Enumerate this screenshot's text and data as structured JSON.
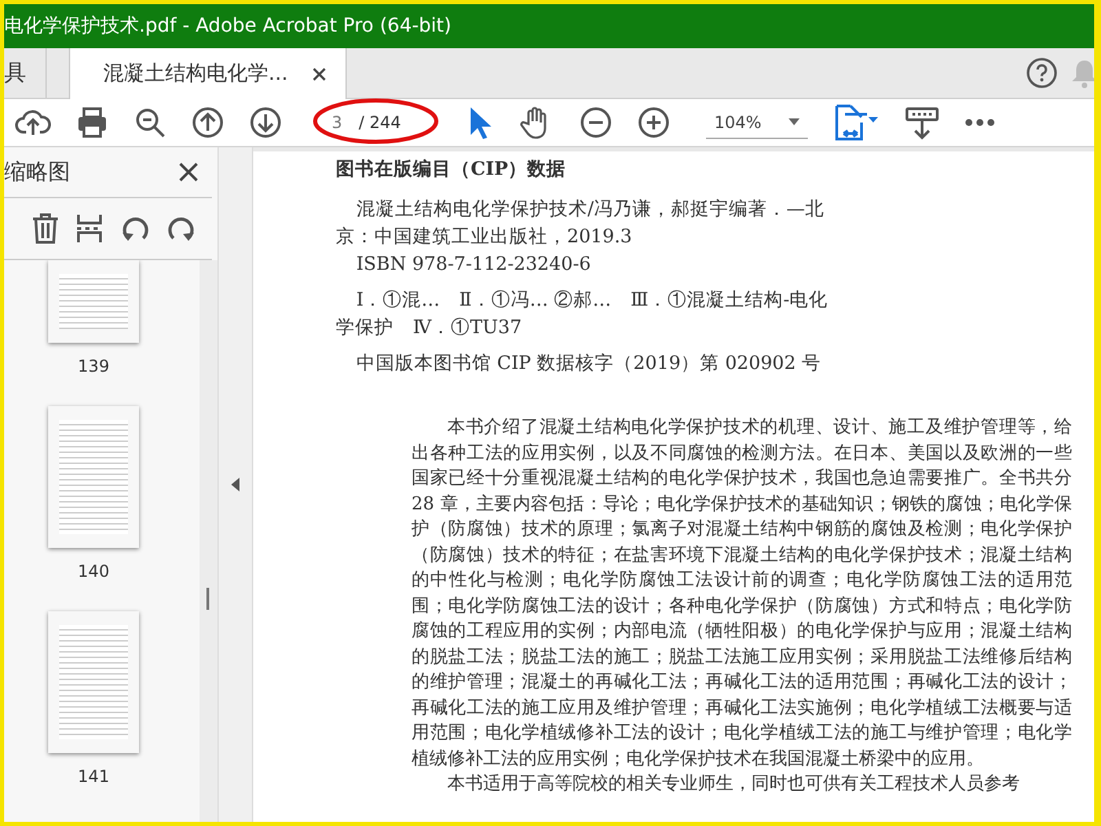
{
  "window": {
    "title": "电化学保护技术.pdf - Adobe Acrobat Pro (64-bit)"
  },
  "tabs": [
    {
      "label": "具",
      "selected": false
    },
    {
      "label": "混凝土结构电化学...",
      "selected": true
    }
  ],
  "toolbar": {
    "page_current": "3",
    "page_total": "/ 244",
    "zoom": "104%"
  },
  "sidebar": {
    "title": "缩略图",
    "thumbnails": [
      {
        "label": "139",
        "selected": false
      },
      {
        "label": "140",
        "selected": false
      },
      {
        "label": "141",
        "selected": false
      }
    ]
  },
  "page": {
    "cip_heading": "图书在版编目（CIP）数据",
    "cip_blocks": [
      [
        "混凝土结构电化学保护技术/冯乃谦，郝挺宇编著．—北京：中国建筑工业出版社，2019.3",
        "ISBN 978-7-112-23240-6"
      ],
      [
        "Ⅰ．①混…　Ⅱ．①冯…  ②郝…　Ⅲ．①混凝土结构-电化学保护　Ⅳ．①TU37"
      ],
      [
        "中国版本图书馆 CIP 数据核字（2019）第 020902 号"
      ]
    ],
    "paragraphs": [
      "本书介绍了混凝土结构电化学保护技术的机理、设计、施工及维护管理等，给出各种工法的应用实例，以及不同腐蚀的检测方法。在日本、美国以及欧洲的一些国家已经十分重视混凝土结构的电化学保护技术，我国也急迫需要推广。全书共分 28 章，主要内容包括：导论；电化学保护技术的基础知识；钢铁的腐蚀；电化学保护（防腐蚀）技术的原理；氯离子对混凝土结构中钢筋的腐蚀及检测；电化学保护（防腐蚀）技术的特征；在盐害环境下混凝土结构的电化学保护技术；混凝土结构的中性化与检测；电化学防腐蚀工法设计前的调查；电化学防腐蚀工法的适用范围；电化学防腐蚀工法的设计；各种电化学保护（防腐蚀）方式和特点；电化学防腐蚀的工程应用的实例；内部电流（牺牲阳极）的电化学保护与应用；混凝土结构的脱盐工法；脱盐工法的施工；脱盐工法施工应用实例；采用脱盐工法维修后结构的维护管理；混凝土的再碱化工法；再碱化工法的适用范围；再碱化工法的设计；再碱化工法的施工应用及维护管理；再碱化工法实施例；电化学植绒工法概要与适用范围；电化学植绒修补工法的设计；电化学植绒工法的施工与维护管理；电化学植绒修补工法的应用实例；电化学保护技术在我国混凝土桥梁中的应用。",
      "本书适用于高等院校的相关专业师生，同时也可供有关工程技术人员参考"
    ]
  }
}
